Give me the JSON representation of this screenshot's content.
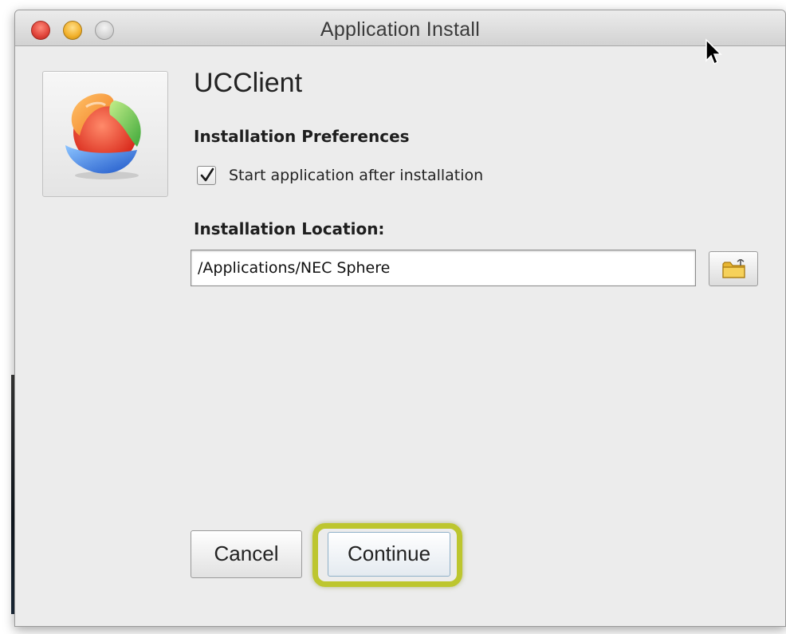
{
  "window": {
    "title": "Application Install",
    "controls": [
      "close",
      "minimize",
      "zoom"
    ]
  },
  "app": {
    "name": "UCClient",
    "icon": "ucclient-sphere-logo"
  },
  "preferences": {
    "heading": "Installation Preferences",
    "start_after_install": {
      "label": "Start application after installation",
      "checked": true
    }
  },
  "location": {
    "heading": "Installation Location:",
    "value": "/Applications/NEC Sphere",
    "browse_icon": "folder-icon"
  },
  "buttons": {
    "cancel": "Cancel",
    "continue": "Continue"
  },
  "colors": {
    "highlight": "#bdc62e",
    "close": "#e0443a",
    "minimize": "#f2b12c",
    "zoom": "#d5d5d5"
  }
}
